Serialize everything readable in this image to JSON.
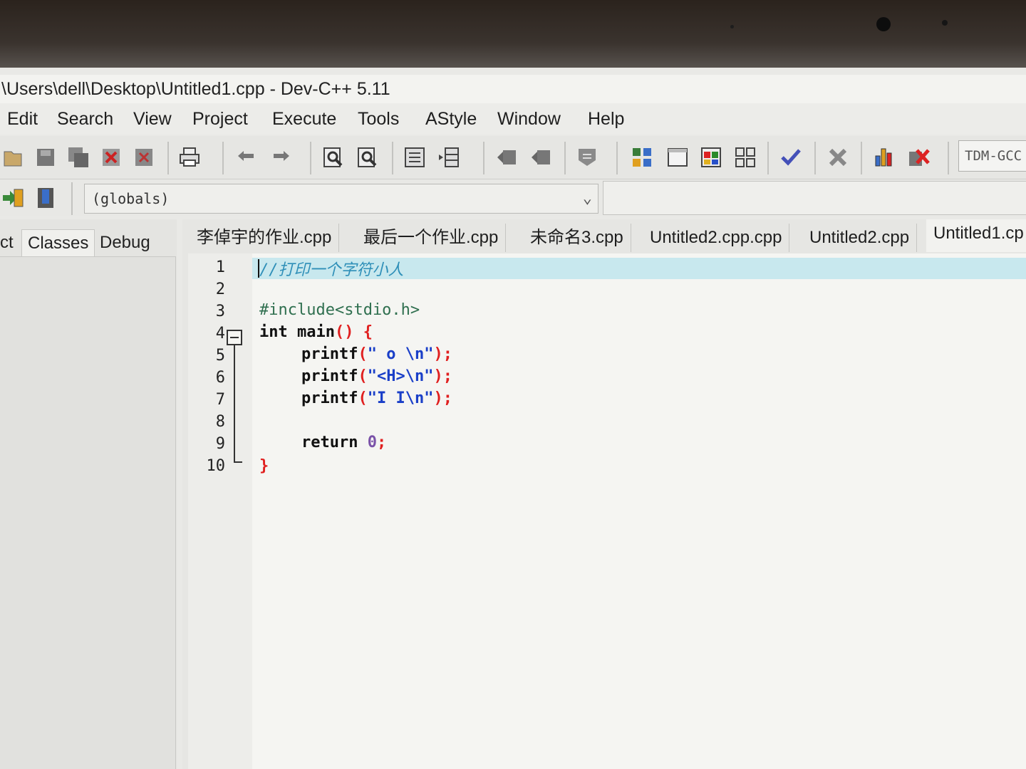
{
  "window": {
    "title": "\\Users\\dell\\Desktop\\Untitled1.cpp - Dev-C++ 5.11"
  },
  "menu": [
    "Edit",
    "Search",
    "View",
    "Project",
    "Execute",
    "Tools",
    "AStyle",
    "Window",
    "Help"
  ],
  "toolbar": {
    "compiler": "TDM-GCC",
    "icons": [
      "open-icon",
      "save-icon",
      "save-all-icon",
      "close-icon",
      "close-all-icon",
      "print-icon",
      "undo-icon",
      "redo-icon",
      "find-icon",
      "replace-icon",
      "indent-icon",
      "unindent-icon",
      "bookmark-prev-icon",
      "bookmark-next-icon",
      "toggle-comment-icon",
      "new-project-icon",
      "new-window-icon",
      "colors-icon",
      "layout-icon",
      "check-icon",
      "stop-icon",
      "chart-icon",
      "debug-icon"
    ]
  },
  "scope": {
    "value": "(globals)"
  },
  "left_panel": {
    "tabs": [
      "ct",
      "Classes",
      "Debug"
    ]
  },
  "editor_tabs": [
    "李倬宇的作业.cpp",
    "最后一个作业.cpp",
    "未命名3.cpp",
    "Untitled2.cpp.cpp",
    "Untitled2.cpp",
    "Untitled1.cp"
  ],
  "code": {
    "line_numbers": [
      "1",
      "2",
      "3",
      "4",
      "5",
      "6",
      "7",
      "8",
      "9",
      "10"
    ],
    "line1": "//打印一个字符小人",
    "line3": "#include<stdio.h>",
    "line4_kw": "int",
    "line4_fn": " main",
    "line4_sym": "() {",
    "printf": "printf",
    "open_paren": "(",
    "close": ");",
    "line5_str": "\" o \\n\"",
    "line6_str": "\"<H>\\n\"",
    "line7_str": "\"I I\\n\"",
    "return_kw": "return",
    "return_val": "0",
    "semicolon": ";",
    "close_brace": "}"
  },
  "colors": {
    "comment": "#2e8fb8",
    "string": "#1a3fc8",
    "symbol": "#e02020",
    "number": "#7a52a8",
    "active_line": "#c8e8ee"
  }
}
